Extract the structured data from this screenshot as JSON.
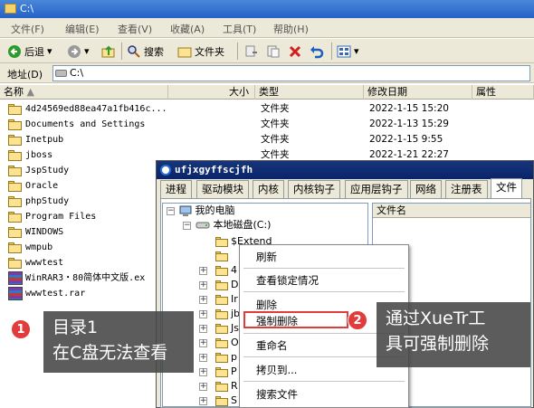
{
  "window": {
    "title": "C:\\"
  },
  "menu": [
    "文件(F)",
    "编辑(E)",
    "查看(V)",
    "收藏(A)",
    "工具(T)",
    "帮助(H)"
  ],
  "toolbar": {
    "back": "后退",
    "search": "搜索",
    "folders": "文件夹"
  },
  "address": {
    "label": "地址(D)",
    "value": "C:\\"
  },
  "columns": [
    "名称",
    "大小",
    "类型",
    "修改日期",
    "属性"
  ],
  "files": [
    {
      "name": "4d24569ed88ea47a1fb416c...",
      "type": "文件夹",
      "date": "2022-1-15 15:20",
      "icon": "folder-icon"
    },
    {
      "name": "Documents and Settings",
      "type": "文件夹",
      "date": "2022-1-13 15:29",
      "icon": "folder-icon"
    },
    {
      "name": "Inetpub",
      "type": "文件夹",
      "date": "2022-1-15 9:55",
      "icon": "folder-icon"
    },
    {
      "name": "jboss",
      "type": "文件夹",
      "date": "2022-1-21 22:27",
      "icon": "folder-icon"
    },
    {
      "name": "JspStudy",
      "type": "",
      "date": "",
      "icon": "folder-icon"
    },
    {
      "name": "Oracle",
      "type": "",
      "date": "",
      "icon": "folder-icon"
    },
    {
      "name": "phpStudy",
      "type": "",
      "date": "",
      "icon": "folder-icon"
    },
    {
      "name": "Program Files",
      "type": "",
      "date": "",
      "icon": "folder-icon"
    },
    {
      "name": "WINDOWS",
      "type": "",
      "date": "",
      "icon": "folder-icon"
    },
    {
      "name": "wmpub",
      "type": "",
      "date": "",
      "icon": "folder-icon"
    },
    {
      "name": "wwwtest",
      "type": "",
      "date": "",
      "icon": "folder-icon"
    },
    {
      "name": "WinRAR3・80简体中文版.ex",
      "type": "",
      "date": "",
      "icon": "winrar-icon"
    },
    {
      "name": "wwwtest.rar",
      "type": "",
      "date": "",
      "icon": "winrar-icon"
    }
  ],
  "xuetr": {
    "title": "ufjxgyffscjfh",
    "tabs": [
      "进程",
      "驱动模块",
      "内核",
      "内核钩子",
      "应用层钩子",
      "网络",
      "注册表",
      "文件"
    ],
    "active_tab": "文件",
    "tree": {
      "root": "我的电脑",
      "drive": "本地磁盘(C:)",
      "items": [
        "$Extend",
        "",
        "4",
        "D",
        "Ir",
        "jb",
        "Js",
        "O",
        "p",
        "P",
        "R",
        "S"
      ]
    },
    "file_list_header": "文件名"
  },
  "context_menu": {
    "items": [
      "刷新",
      "查看锁定情况",
      "删除",
      "强制删除",
      "重命名",
      "拷贝到...",
      "搜索文件"
    ],
    "highlighted": "强制删除"
  },
  "callouts": [
    {
      "number": "1",
      "line1": "目录1",
      "line2": "在C盘无法查看"
    },
    {
      "number": "2",
      "line1": "通过XueTr工",
      "line2": "具可强制删除"
    }
  ],
  "colors": {
    "accent_red": "#e03c3c",
    "title_blue": "#2361c8",
    "xuetr_title": "#0a246a"
  }
}
